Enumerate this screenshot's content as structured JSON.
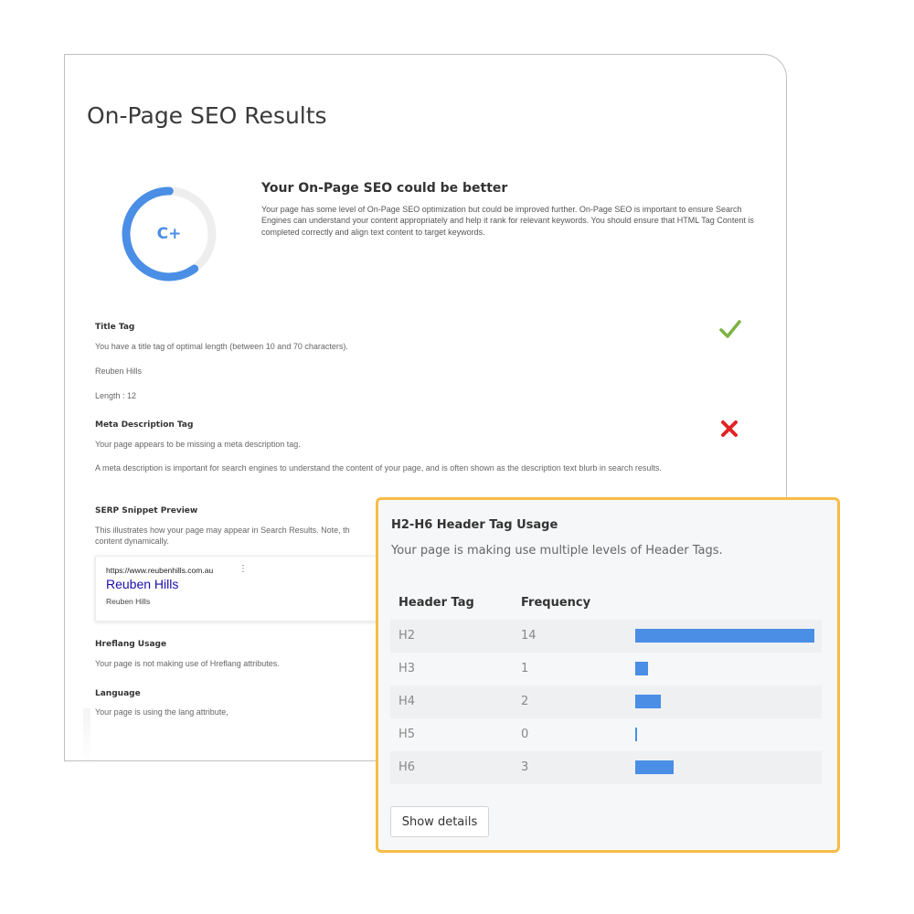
{
  "report": {
    "title": "On-Page SEO Results",
    "grade": "C+",
    "grade_score": 0.6,
    "summary_heading": "Your On-Page SEO could be better",
    "summary_text": "Your page has some level of On-Page SEO optimization but could be improved further. On-Page SEO is important to ensure Search Engines can understand your content appropriately and help it rank for relevant keywords. You should ensure that HTML Tag Content is completed correctly and align text content to target keywords."
  },
  "title_tag": {
    "heading": "Title Tag",
    "status": "pass",
    "description": "You have a title tag of optimal length (between 10 and 70 characters).",
    "value": "Reuben Hills",
    "length": "Length : 12"
  },
  "meta_description": {
    "heading": "Meta Description Tag",
    "status": "fail",
    "description": "Your page appears to be missing a meta description tag.",
    "note": "A meta description is important for search engines to understand the content of your page, and is often shown as the description text blurb in search results."
  },
  "serp": {
    "heading": "SERP Snippet Preview",
    "description": "This illustrates how your page may appear in Search Results. Note, th",
    "description_line2": "content dynamically.",
    "url": "https://www.reubenhills.com.au",
    "menu_glyph": "⋮",
    "title": "Reuben Hills",
    "snippet": "Reuben Hills"
  },
  "hreflang": {
    "heading": "Hreflang Usage",
    "description": "Your page is not making use of Hreflang attributes."
  },
  "language": {
    "heading": "Language",
    "description": "Your page is using the lang attribute,"
  },
  "header_usage": {
    "title": "H2-H6 Header Tag Usage",
    "subtitle": "Your page is making use multiple levels of Header Tags.",
    "col_tag": "Header Tag",
    "col_frequency": "Frequency",
    "rows": [
      {
        "tag": "H2",
        "frequency": 14
      },
      {
        "tag": "H3",
        "frequency": 1
      },
      {
        "tag": "H4",
        "frequency": 2
      },
      {
        "tag": "H5",
        "frequency": 0
      },
      {
        "tag": "H6",
        "frequency": 3
      }
    ],
    "show_details_label": "Show details"
  },
  "colors": {
    "accent_blue": "#4a8ee6",
    "pass_green": "#7cb342",
    "fail_red": "#e02424",
    "highlight_orange": "#f7bc48"
  },
  "icons": {
    "pass": "check-icon",
    "fail": "cross-icon"
  }
}
